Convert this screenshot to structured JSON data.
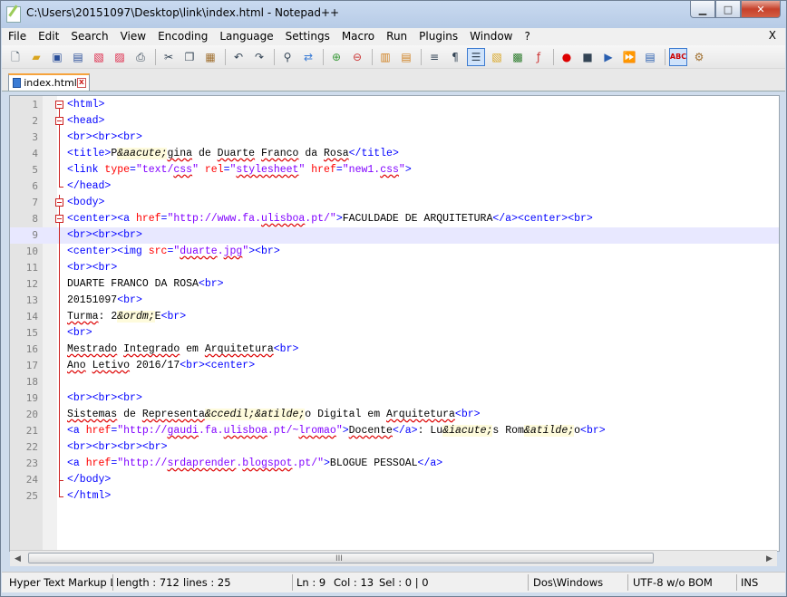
{
  "window": {
    "title": "C:\\Users\\20151097\\Desktop\\link\\index.html - Notepad++",
    "controls": {
      "minimize": "▁",
      "maximize": "□",
      "close": "✕"
    }
  },
  "menu": [
    "File",
    "Edit",
    "Search",
    "View",
    "Encoding",
    "Language",
    "Settings",
    "Macro",
    "Run",
    "Plugins",
    "Window",
    "?"
  ],
  "menu_close": "X",
  "toolbar": {
    "icons": [
      "new-file-icon",
      "open-file-icon",
      "save-icon",
      "save-all-icon",
      "close-icon",
      "close-all-icon",
      "print-icon",
      "cut-icon",
      "copy-icon",
      "paste-icon",
      "undo-icon",
      "redo-icon",
      "find-icon",
      "replace-icon",
      "zoom-in-icon",
      "zoom-out-icon",
      "sync-vertical-icon",
      "sync-horizontal-icon",
      "word-wrap-icon",
      "show-all-chars-icon",
      "indent-guide-icon",
      "language-folder-icon",
      "document-map-icon",
      "function-list-icon",
      "record-macro-icon",
      "stop-macro-icon",
      "play-macro-icon",
      "run-macro-multiple-icon",
      "save-macro-icon",
      "spell-check-icon",
      "spell-check-settings-icon"
    ]
  },
  "tab": {
    "label": "index.html"
  },
  "editor": {
    "current_line": 9,
    "lines": [
      {
        "n": "1"
      },
      {
        "n": "2"
      },
      {
        "n": "3"
      },
      {
        "n": "4"
      },
      {
        "n": "5"
      },
      {
        "n": "6"
      },
      {
        "n": "7"
      },
      {
        "n": "8"
      },
      {
        "n": "9"
      },
      {
        "n": "10"
      },
      {
        "n": "11"
      },
      {
        "n": "12"
      },
      {
        "n": "13"
      },
      {
        "n": "14"
      },
      {
        "n": "15"
      },
      {
        "n": "16"
      },
      {
        "n": "17"
      },
      {
        "n": "18"
      },
      {
        "n": "19"
      },
      {
        "n": "20"
      },
      {
        "n": "21"
      },
      {
        "n": "22"
      },
      {
        "n": "23"
      },
      {
        "n": "24"
      },
      {
        "n": "25"
      }
    ],
    "code": [
      "<html>",
      "<head>",
      "<br><br><br>",
      "<title>P&aacute;gina de Duarte Franco da Rosa</title>",
      "<link type=\"text/css\" rel=\"stylesheet\" href=\"new1.css\">",
      "</head>",
      "<body>",
      "<center><a href=\"http://www.fa.ulisboa.pt/\">FACULDADE DE ARQUITETURA</a><center><br>",
      "<br><br><br>",
      "<center><img src=\"duarte.jpg\"><br>",
      "<br><br>",
      "DUARTE FRANCO DA ROSA<br>",
      "20151097<br>",
      "Turma: 2&ordm;E<br>",
      "<br>",
      "Mestrado Integrado em Arquitetura<br>",
      "Ano Letivo 2016/17<br><center>",
      "",
      "<br><br><br>",
      "Sistemas de Representa&ccedil;&atilde;o Digital em Arquitetura<br>",
      "<a href=\"http://gaudi.fa.ulisboa.pt/~lromao\">Docente</a>: Lu&iacute;s Rom&atilde;o<br>",
      "<br><br><br><br>",
      "<a href=\"http://srdaprender.blogspot.pt/\">BLOGUE PESSOAL</a>",
      "</body>",
      "</html>"
    ]
  },
  "hscroll": {
    "left": "◀",
    "right": "▶",
    "grip": "III"
  },
  "status": {
    "language": "Hyper Text Markup L",
    "length": "length : 712",
    "lines": "lines : 25",
    "ln": "Ln : 9",
    "col": "Col : 13",
    "sel": "Sel : 0 | 0",
    "eol": "Dos\\Windows",
    "encoding": "UTF-8 w/o BOM",
    "mode": "INS"
  }
}
